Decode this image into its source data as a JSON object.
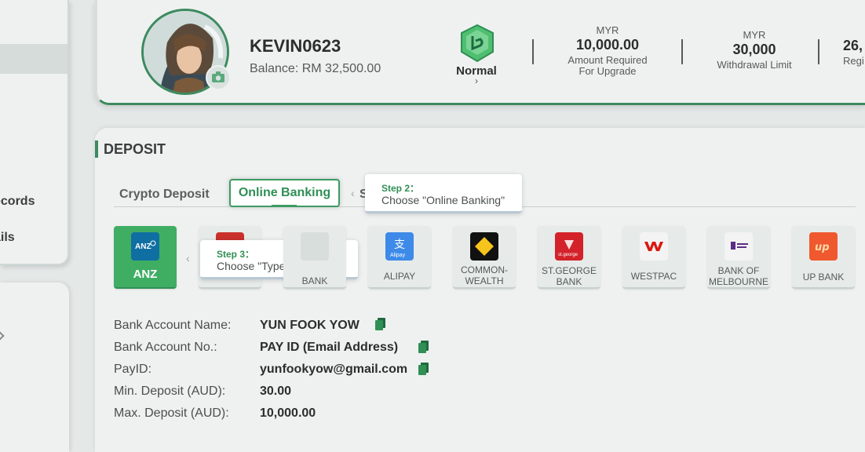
{
  "sidebar": {
    "items": [
      {
        "label": "ecords"
      },
      {
        "label": "ails"
      }
    ]
  },
  "profile": {
    "username": "KEVIN0623",
    "balance": "Balance: RM 32,500.00",
    "vip_level": "Normal",
    "stats": [
      {
        "currency": "MYR",
        "value": "10,000.00",
        "label_line1": "Amount Required",
        "label_line2": "For Upgrade"
      },
      {
        "currency": "MYR",
        "value": "30,000",
        "label_line1": "Withdrawal Limit",
        "label_line2": ""
      },
      {
        "currency": "",
        "value": "26,",
        "label_line1": "Regi",
        "label_line2": ""
      }
    ]
  },
  "deposit": {
    "title": "DEPOSIT",
    "tabs": [
      {
        "label": "Crypto Deposit"
      },
      {
        "label": "Online Banking"
      },
      {
        "label": "S"
      }
    ],
    "tooltips": [
      {
        "step": "Step 2：",
        "text": "Choose \"Online Banking\""
      },
      {
        "step": "Step 3：",
        "text": "Choose \"Type of Bank\""
      }
    ],
    "banks": [
      {
        "name": "ANZ",
        "logo": "ANZ",
        "selected": true,
        "color": "#0f6fa3"
      },
      {
        "name": "",
        "selected": false,
        "color": "#c9302c"
      },
      {
        "name": "BANK",
        "selected": false,
        "color": "#d8dedc"
      },
      {
        "name": "ALIPAY",
        "logo": "Alipay",
        "selected": false,
        "color": "#1677ff"
      },
      {
        "name_line1": "COMMON-",
        "name_line2": "WEALTH",
        "selected": false,
        "color": "#111111"
      },
      {
        "name_line1": "ST.GEORGE",
        "name_line2": "BANK",
        "logo": "st.george",
        "selected": false,
        "color": "#d3222a"
      },
      {
        "name": "WESTPAC",
        "selected": false,
        "color": "#da1710"
      },
      {
        "name_line1": "BANK OF",
        "name_line2": "MELBOURNE",
        "selected": false,
        "color": "#5b2d86"
      },
      {
        "name": "UP BANK",
        "logo": "up",
        "selected": false,
        "color": "#f0582f"
      }
    ],
    "details": [
      {
        "label": "Bank Account Name:",
        "value": "YUN FOOK YOW"
      },
      {
        "label": "Bank Account No.:",
        "value": "PAY ID (Email Address)"
      },
      {
        "label": "PayID:",
        "value": "yunfookyow@gmail.com"
      },
      {
        "label": "Min. Deposit (AUD):",
        "value": "30.00"
      },
      {
        "label": "Max. Deposit (AUD):",
        "value": "10,000.00"
      }
    ]
  },
  "colors": {
    "accent": "#3d8a5e",
    "selected_bank": "#3fae63",
    "tab_active": "#2f8f55"
  }
}
